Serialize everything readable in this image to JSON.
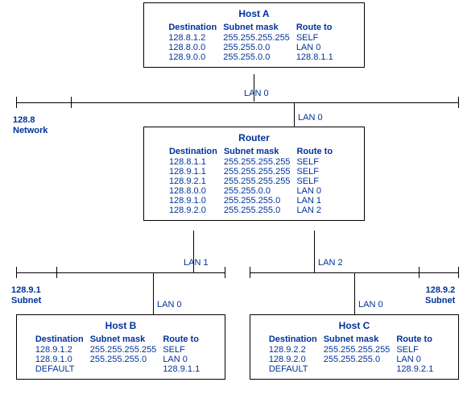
{
  "hostA": {
    "title": "Host A",
    "headers": [
      "Destination",
      "Subnet mask",
      "Route to"
    ],
    "rows": [
      [
        "128.8.1.2",
        "255.255.255.255",
        "SELF"
      ],
      [
        "128.8.0.0",
        "255.255.0.0",
        "LAN 0"
      ],
      [
        "128.9.0.0",
        "255.255.0.0",
        "128.8.1.1"
      ]
    ]
  },
  "router": {
    "title": "Router",
    "headers": [
      "Destination",
      "Subnet mask",
      "Route to"
    ],
    "rows": [
      [
        "128.8.1.1",
        "255.255.255.255",
        "SELF"
      ],
      [
        "128.9.1.1",
        "255.255.255.255",
        "SELF"
      ],
      [
        "128.9.2.1",
        "255.255.255.255",
        "SELF"
      ],
      [
        "128.8.0.0",
        "255.255.0.0",
        "LAN 0"
      ],
      [
        "128.9.1.0",
        "255.255.255.0",
        "LAN 1"
      ],
      [
        "128.9.2.0",
        "255.255.255.0",
        "LAN 2"
      ]
    ]
  },
  "hostB": {
    "title": "Host B",
    "headers": [
      "Destination",
      "Subnet mask",
      "Route to"
    ],
    "rows": [
      [
        "128.9.1.2",
        "255.255.255.255",
        "SELF"
      ],
      [
        "128.9.1.0",
        "255.255.255.0",
        "LAN 0"
      ],
      [
        "DEFAULT",
        "",
        "128.9.1.1"
      ]
    ]
  },
  "hostC": {
    "title": "Host C",
    "headers": [
      "Destination",
      "Subnet mask",
      "Route to"
    ],
    "rows": [
      [
        "128.9.2.2",
        "255.255.255.255",
        "SELF"
      ],
      [
        "128.9.2.0",
        "255.255.255.0",
        "LAN 0"
      ],
      [
        "DEFAULT",
        "",
        "128.9.2.1"
      ]
    ]
  },
  "labels": {
    "network": "128.8\nNetwork",
    "subnet1": "128.9.1\nSubnet",
    "subnet2": "128.9.2\nSubnet",
    "lan0": "LAN 0",
    "lan1": "LAN 1",
    "lan2": "LAN 2"
  },
  "chart_data": {
    "type": "network-topology",
    "nodes": [
      {
        "id": "HostA",
        "label": "Host A",
        "routing_table": [
          {
            "destination": "128.8.1.2",
            "mask": "255.255.255.255",
            "route": "SELF"
          },
          {
            "destination": "128.8.0.0",
            "mask": "255.255.0.0",
            "route": "LAN 0"
          },
          {
            "destination": "128.9.0.0",
            "mask": "255.255.0.0",
            "route": "128.8.1.1"
          }
        ]
      },
      {
        "id": "Router",
        "label": "Router",
        "routing_table": [
          {
            "destination": "128.8.1.1",
            "mask": "255.255.255.255",
            "route": "SELF"
          },
          {
            "destination": "128.9.1.1",
            "mask": "255.255.255.255",
            "route": "SELF"
          },
          {
            "destination": "128.9.2.1",
            "mask": "255.255.255.255",
            "route": "SELF"
          },
          {
            "destination": "128.8.0.0",
            "mask": "255.255.0.0",
            "route": "LAN 0"
          },
          {
            "destination": "128.9.1.0",
            "mask": "255.255.255.0",
            "route": "LAN 1"
          },
          {
            "destination": "128.9.2.0",
            "mask": "255.255.255.0",
            "route": "LAN 2"
          }
        ]
      },
      {
        "id": "HostB",
        "label": "Host B",
        "routing_table": [
          {
            "destination": "128.9.1.2",
            "mask": "255.255.255.255",
            "route": "SELF"
          },
          {
            "destination": "128.9.1.0",
            "mask": "255.255.255.0",
            "route": "LAN 0"
          },
          {
            "destination": "DEFAULT",
            "mask": "",
            "route": "128.9.1.1"
          }
        ]
      },
      {
        "id": "HostC",
        "label": "Host C",
        "routing_table": [
          {
            "destination": "128.9.2.2",
            "mask": "255.255.255.255",
            "route": "SELF"
          },
          {
            "destination": "128.9.2.0",
            "mask": "255.255.255.0",
            "route": "LAN 0"
          },
          {
            "destination": "DEFAULT",
            "mask": "",
            "route": "128.9.2.1"
          }
        ]
      }
    ],
    "segments": [
      {
        "id": "128.8 Network",
        "connects": [
          "HostA:LAN0",
          "Router:LAN0"
        ]
      },
      {
        "id": "128.9.1 Subnet",
        "connects": [
          "Router:LAN1",
          "HostB:LAN0"
        ]
      },
      {
        "id": "128.9.2 Subnet",
        "connects": [
          "Router:LAN2",
          "HostC:LAN0"
        ]
      }
    ]
  }
}
